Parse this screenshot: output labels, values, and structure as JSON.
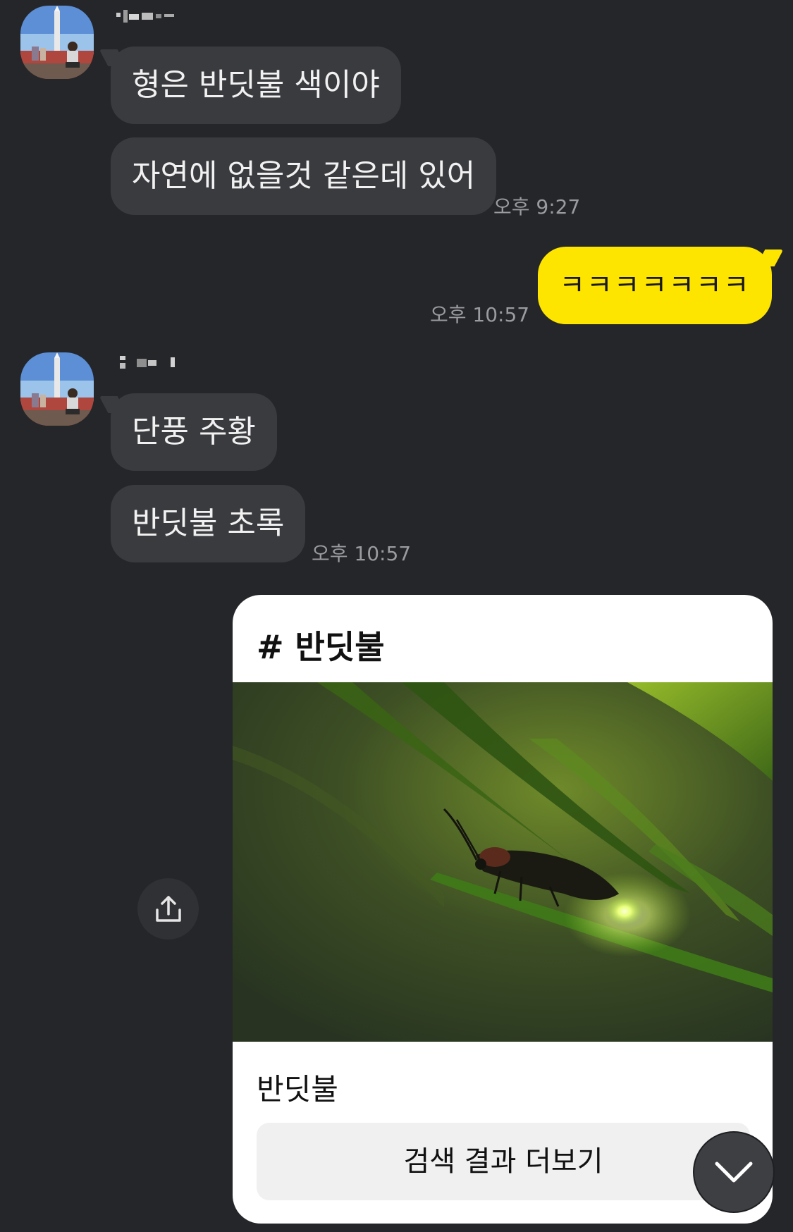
{
  "colors": {
    "background": "#252629",
    "received_bubble": "#3a3b3f",
    "sent_bubble": "#fee500",
    "timestamp": "#9a9ba0",
    "card_background": "#ffffff"
  },
  "messages": [
    {
      "sender": "other",
      "bubbles": [
        {
          "text": "형은 반딧불 색이야"
        },
        {
          "text": "자연에 없을것 같은데 있어"
        }
      ],
      "time": "오후 9:27"
    },
    {
      "sender": "me",
      "bubbles": [
        {
          "text": "ㅋㅋㅋㅋㅋㅋㅋ"
        }
      ],
      "time": "오후 10:57"
    },
    {
      "sender": "other",
      "bubbles": [
        {
          "text": "단풍 주황"
        },
        {
          "text": "반딧불 초록"
        }
      ],
      "time": "오후 10:57"
    }
  ],
  "search_card": {
    "title": "# 반딧불",
    "caption": "반딧불",
    "more_button_label": "검색 결과 더보기"
  },
  "icons": {
    "share": "share-icon",
    "scroll_down": "chevron-down-icon"
  }
}
